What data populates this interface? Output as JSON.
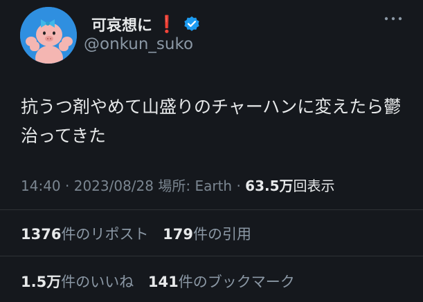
{
  "profile": {
    "display_name": "可哀想に",
    "display_emoji": "❗",
    "handle": "@onkun_suko",
    "avatar_icon": "pig-character-avatar",
    "verified_icon": "verified-badge-icon",
    "more_icon": "more-options-icon"
  },
  "tweet": {
    "text": "抗うつ剤やめて山盛りのチャーハンに変えたら鬱治ってきた",
    "time": "14:40",
    "date": "2023/08/28",
    "location_label": "場所: Earth",
    "views_count": "63.5万",
    "views_label": "回表示"
  },
  "stats": {
    "reposts_count": "1376",
    "reposts_label": "件のリポスト",
    "quotes_count": "179",
    "quotes_label": "件の引用",
    "likes_count": "1.5万",
    "likes_label": "件のいいね",
    "bookmarks_count": "141",
    "bookmarks_label": "件のブックマーク"
  },
  "colors": {
    "background": "#15181d",
    "text_primary": "#e7e9ea",
    "text_secondary": "#8b98a5",
    "verified": "#1d9bf0",
    "avatar_bg": "#2f8fe0"
  }
}
